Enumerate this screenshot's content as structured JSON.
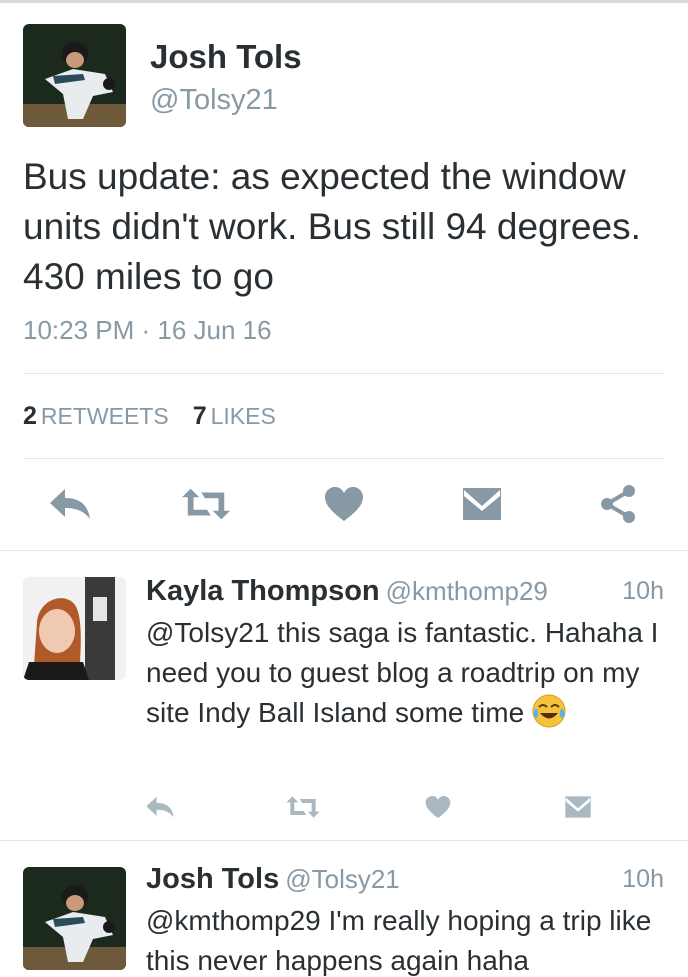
{
  "main_tweet": {
    "name": "Josh Tols",
    "handle": "@Tolsy21",
    "text": "Bus update: as expected the window units didn't work. Bus still 94 degrees. 430 miles to go",
    "timestamp": "10:23 PM · 16 Jun 16",
    "retweets_count": "2",
    "retweets_label": "RETWEETS",
    "likes_count": "7",
    "likes_label": "LIKES",
    "actions": [
      "reply-icon",
      "retweet-icon",
      "heart-icon",
      "message-icon",
      "share-icon"
    ]
  },
  "replies": [
    {
      "name": "Kayla Thompson",
      "handle": "@kmthomp29",
      "time": "10h",
      "text": "@Tolsy21 this saga is fantastic. Hahaha I need you to guest blog a roadtrip on my site Indy Ball Island some time",
      "emoji": "face-with-tears-of-joy"
    },
    {
      "name": "Josh Tols",
      "handle": "@Tolsy21",
      "time": "10h",
      "text": "@kmthomp29 I'm really hoping a trip like this never happens again haha"
    }
  ],
  "colors": {
    "text": "#292f33",
    "secondary": "#8899a6",
    "icon": "#8899a6",
    "divider": "#e1e8ed"
  }
}
